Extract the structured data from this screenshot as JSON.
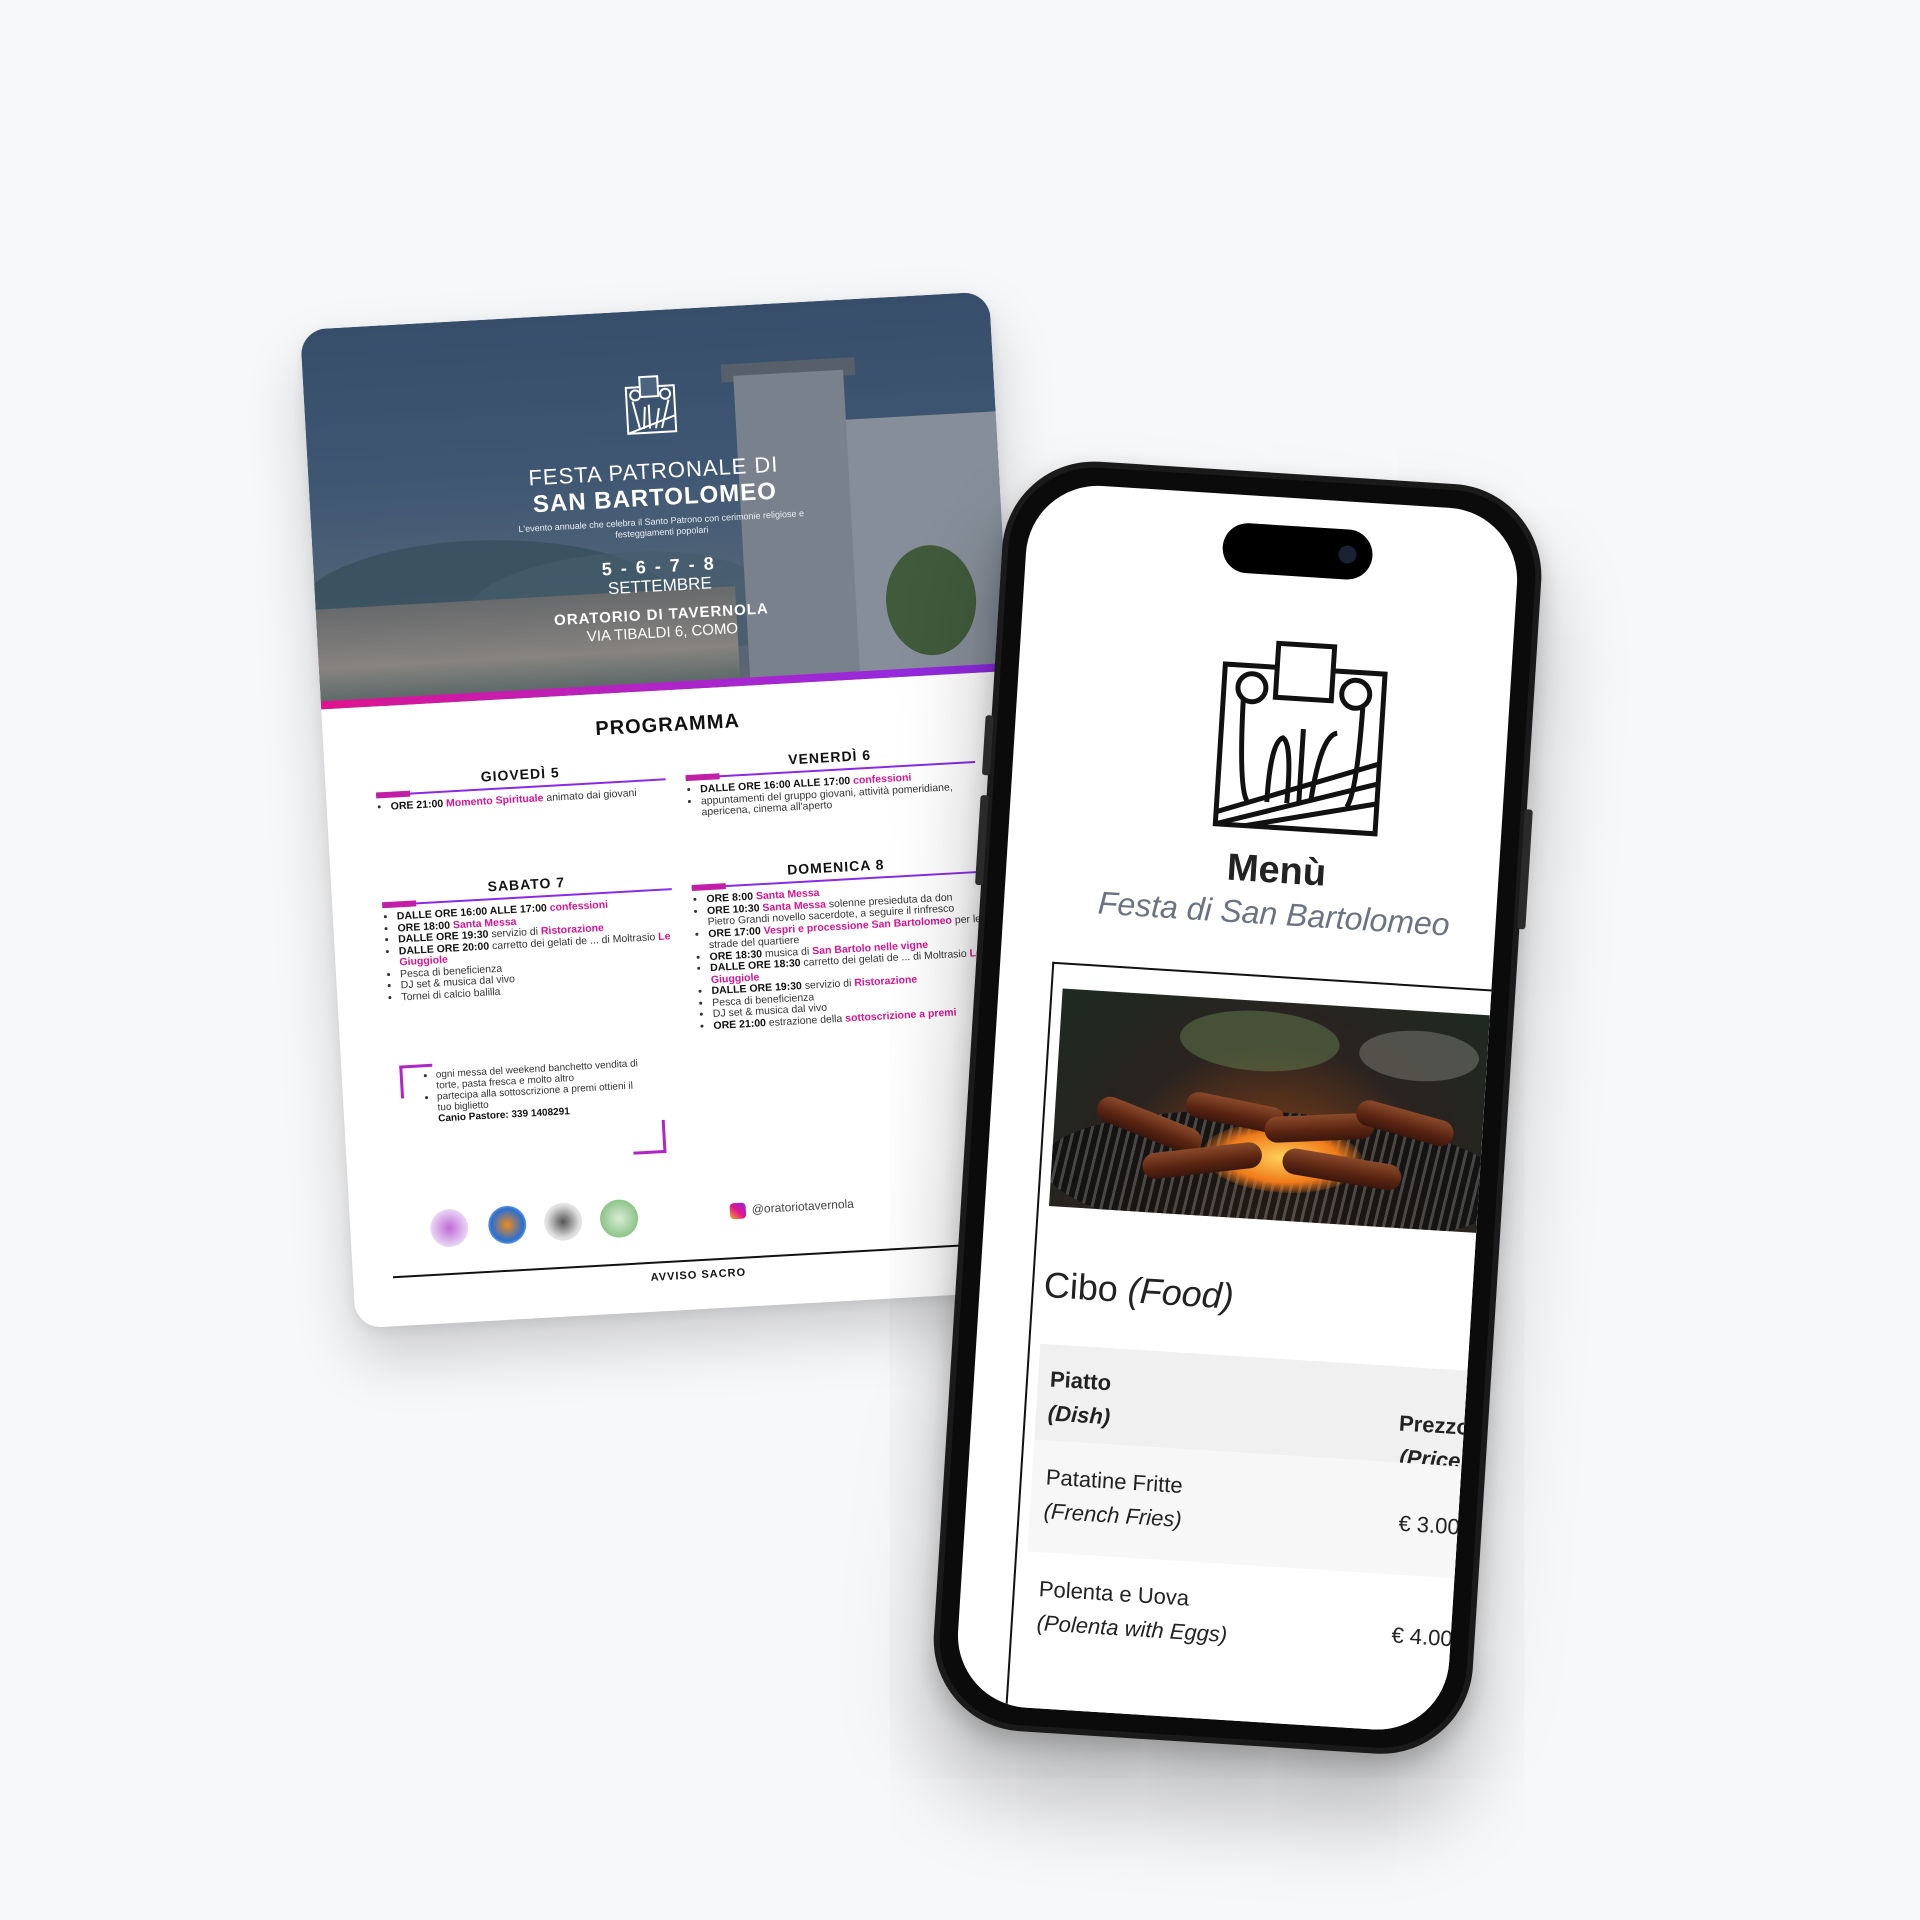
{
  "flyer": {
    "title_line1": "FESTA PATRONALE DI",
    "title_line2": "SAN BARTOLOMEO",
    "description": "L'evento annuale che celebra il Santo Patrono con cerimonie religiose e festeggiamenti popolari",
    "dates": "5 - 6 - 7 - 8",
    "month": "SETTEMBRE",
    "venue": "ORATORIO DI TAVERNOLA",
    "address": "VIA TIBALDI 6, COMO",
    "program_title": "PROGRAMMA",
    "days": [
      {
        "heading": "GIOVEDÌ 5",
        "items": [
          [
            "ORE 21:00",
            "Momento Spirituale",
            "animato dai giovani"
          ]
        ]
      },
      {
        "heading": "VENERDÌ 6",
        "items": [
          [
            "DALLE ORE 16:00 ALLE 17:00",
            "confessioni",
            ""
          ],
          [
            "",
            "",
            "appuntamenti del gruppo giovani, attività pomeridiane, apericena, cinema all'aperto"
          ]
        ]
      },
      {
        "heading": "SABATO 7",
        "items": [
          [
            "DALLE ORE 16:00 ALLE 17:00",
            "confessioni",
            ""
          ],
          [
            "ORE 18:00",
            "Santa Messa",
            ""
          ],
          [
            "DALLE ORE 19:30",
            "Ristorazione",
            "servizio di"
          ],
          [
            "DALLE ORE 20:00",
            "Le Giuggiole",
            "carretto dei gelati de ... di Moltrasio"
          ],
          [
            "",
            "",
            "Pesca di beneficienza"
          ],
          [
            "",
            "",
            "DJ set & musica dal vivo"
          ],
          [
            "",
            "",
            "Tornei di calcio balilla"
          ]
        ]
      },
      {
        "heading": "DOMENICA 8",
        "items": [
          [
            "ORE 8:00",
            "Santa Messa",
            ""
          ],
          [
            "ORE 10:30",
            "Santa Messa",
            "solenne presieduta da don Pietro Grandi novello sacerdote, a seguire il rinfresco"
          ],
          [
            "ORE 17:00",
            "Vespri e processione San Bartolomeo",
            "per le strade del quartiere"
          ],
          [
            "ORE 18:30",
            "San Bartolo nelle vigne",
            "musica di"
          ],
          [
            "DALLE ORE 18:30",
            "Le Giuggiole",
            "carretto dei gelati de ... di Moltrasio"
          ],
          [
            "DALLE ORE 19:30",
            "Ristorazione",
            "servizio di"
          ],
          [
            "",
            "",
            "Pesca di beneficienza"
          ],
          [
            "",
            "",
            "DJ set & musica dal vivo"
          ],
          [
            "ORE 21:00",
            "sottoscrizione a premi",
            "estrazione della"
          ]
        ]
      }
    ],
    "note_lines": [
      "ogni messa del weekend banchetto vendita di torte, pasta fresca e molto altro",
      "partecipa alla sottoscrizione a premi ottieni il tuo biglietto",
      "Canio Pastore: 339 1408291"
    ],
    "instagram": "@oratoriotavernola",
    "footer": "AVVISO SACRO",
    "accent_pink": "#d6168f",
    "accent_purple": "#8a2be2"
  },
  "phone": {
    "menu_title": "Menù",
    "menu_subtitle": "Festa di San Bartolomeo",
    "section_title": "Cibo",
    "section_title_en": "(Food)",
    "columns": {
      "dish": "Piatto",
      "dish_en": "(Dish)",
      "price": "Prezzo",
      "price_en": "(Price)"
    },
    "rows": [
      {
        "name": "Patatine Fritte",
        "name_en": "(French Fries)",
        "price": "€ 3.00"
      },
      {
        "name": "Polenta e Uova",
        "name_en": "(Polenta with Eggs)",
        "price": "€ 4.00"
      }
    ]
  }
}
